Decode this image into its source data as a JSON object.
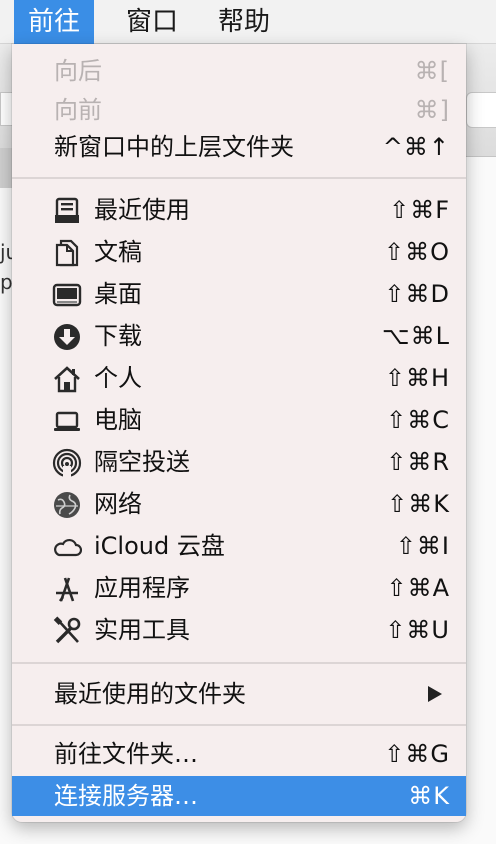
{
  "menubar": {
    "items": [
      {
        "label": "前往",
        "active": true
      },
      {
        "label": "窗口",
        "active": false
      },
      {
        "label": "帮助",
        "active": false
      }
    ]
  },
  "background_window": {
    "text1": "ju",
    "text2": "po"
  },
  "menu": {
    "nav": [
      {
        "label": "向后",
        "shortcut": "⌘[",
        "enabled": false
      },
      {
        "label": "向前",
        "shortcut": "⌘]",
        "enabled": false
      },
      {
        "label": "新窗口中的上层文件夹",
        "shortcut": "^⌘↑",
        "enabled": true
      }
    ],
    "places": [
      {
        "label": "最近使用",
        "shortcut": "⇧⌘F",
        "icon": "recents-icon"
      },
      {
        "label": "文稿",
        "shortcut": "⇧⌘O",
        "icon": "documents-icon"
      },
      {
        "label": "桌面",
        "shortcut": "⇧⌘D",
        "icon": "desktop-icon"
      },
      {
        "label": "下载",
        "shortcut": "⌥⌘L",
        "icon": "downloads-icon"
      },
      {
        "label": "个人",
        "shortcut": "⇧⌘H",
        "icon": "home-icon"
      },
      {
        "label": "电脑",
        "shortcut": "⇧⌘C",
        "icon": "computer-icon"
      },
      {
        "label": "隔空投送",
        "shortcut": "⇧⌘R",
        "icon": "airdrop-icon"
      },
      {
        "label": "网络",
        "shortcut": "⇧⌘K",
        "icon": "network-icon"
      },
      {
        "label": "iCloud 云盘",
        "shortcut": "⇧⌘I",
        "icon": "icloud-icon"
      },
      {
        "label": "应用程序",
        "shortcut": "⇧⌘A",
        "icon": "applications-icon"
      },
      {
        "label": "实用工具",
        "shortcut": "⇧⌘U",
        "icon": "utilities-icon"
      }
    ],
    "recent_folders": {
      "label": "最近使用的文件夹",
      "submenu_indicator": "▶"
    },
    "goto_folder": {
      "label": "前往文件夹…",
      "shortcut": "⇧⌘G"
    },
    "connect_server": {
      "label": "连接服务器…",
      "shortcut": "⌘K",
      "selected": true
    }
  },
  "colors": {
    "accent": "#3d8ee6",
    "menu_bg": "#f6eeee",
    "disabled_text": "#b8b2b2"
  }
}
